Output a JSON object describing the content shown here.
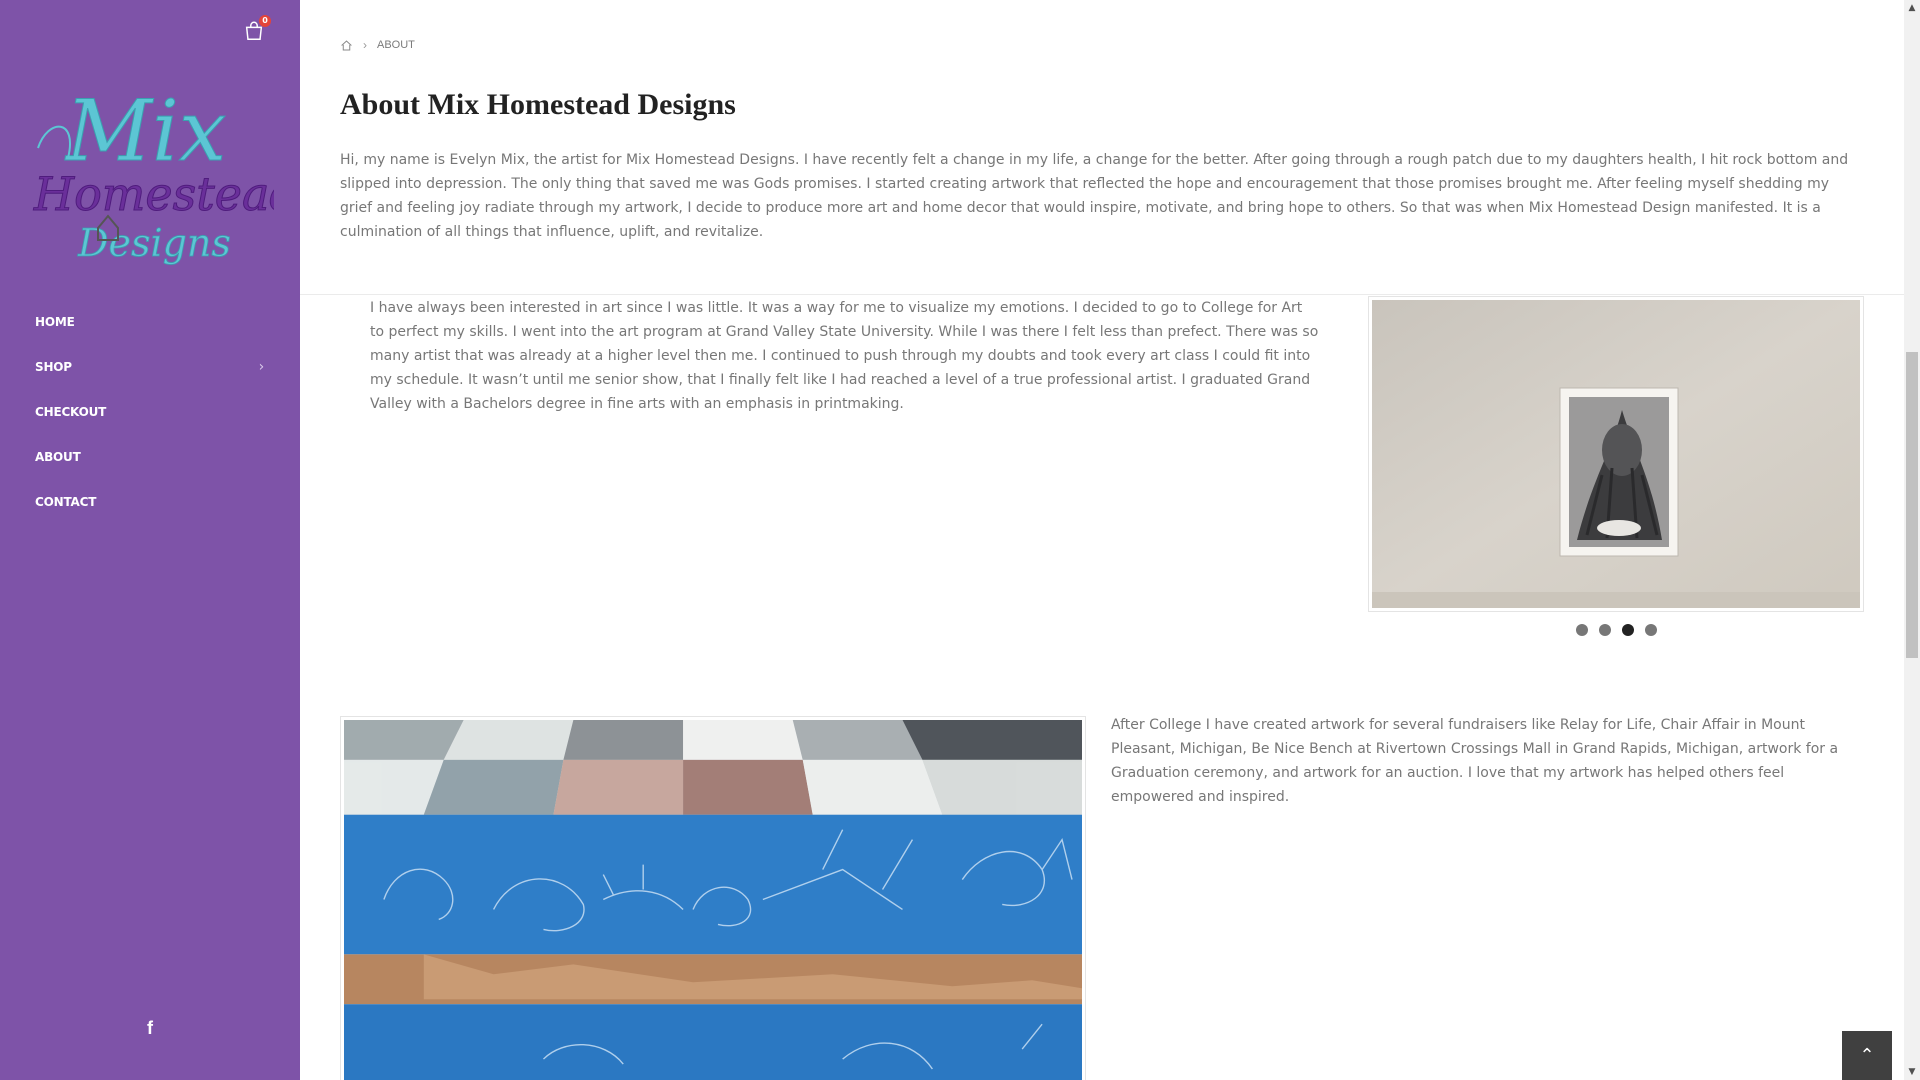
{
  "sidebar": {
    "cart_count": "0",
    "logo_text": "Mix Homestead Designs",
    "nav": [
      {
        "label": "HOME"
      },
      {
        "label": "SHOP"
      },
      {
        "label": "CHECKOUT"
      },
      {
        "label": "ABOUT"
      },
      {
        "label": "CONTACT"
      }
    ],
    "bg_color": "#7e53a8"
  },
  "breadcrumb": {
    "current": "ABOUT"
  },
  "page": {
    "title": "About Mix Homestead Designs",
    "intro": "Hi, my name is Evelyn Mix, the artist for Mix Homestead Designs. I have recently felt a change in my life, a change for the better. After going through a rough patch due to my daughters health,  I hit rock bottom and slipped into depression. The only thing that saved me  was Gods promises. I started creating artwork that reflected the hope and encouragement that those promises brought me. After feeling myself shedding my grief and feeling joy radiate through my artwork, I decide to produce more art and home decor that would inspire, motivate, and  bring hope to others. So that was when Mix Homestead Design manifested. It is a culmination of all things that influence, uplift, and revitalize.",
    "paragraph2": "I have always been interested in art since I was little. It was a way for me to visualize my emotions.  I decided to go to College for Art to perfect my skills. I went into the art program at Grand Valley State University. While I was there I felt less than prefect. There was so many artist that was already at a higher level then me. I continued to push through my doubts and  took every art class I could fit into my schedule. It wasn’t until me senior show, that I finally felt like I had reached a level of a true professional artist.  I graduated Grand Valley with a Bachelors degree in fine arts with an emphasis in printmaking.",
    "paragraph3": "After College I have created artwork for several fundraisers like Relay for Life, Chair Affair in Mount Pleasant, Michigan, Be Nice Bench at Rivertown Crossings Mall in Grand Rapids, Michigan, artwork for a Graduation ceremony, and artwork for an auction. I love that my artwork has helped others feel empowered and inspired."
  },
  "slider": {
    "dot_count": 4,
    "active_dot": 3
  },
  "icons": {
    "cart": "shopping-bag-icon",
    "home": "home-icon",
    "facebook": "facebook-icon",
    "back_to_top": "chevron-up-icon"
  }
}
